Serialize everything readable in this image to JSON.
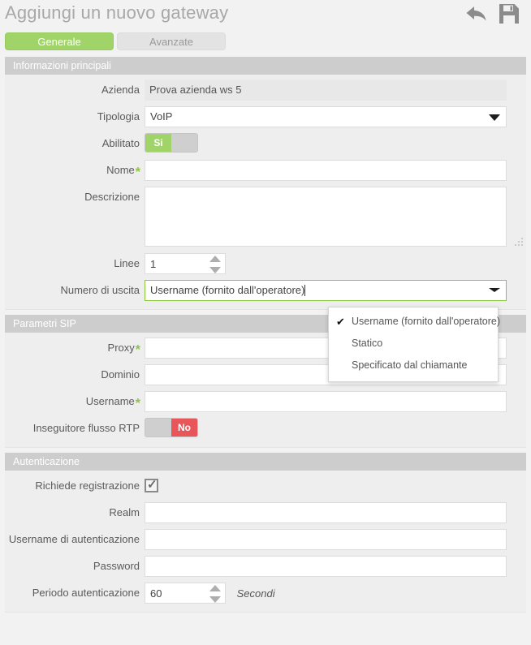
{
  "header": {
    "title": "Aggiungi un nuovo gateway",
    "actions": [
      {
        "name": "back-icon",
        "label": "Indietro"
      },
      {
        "name": "save-icon",
        "label": "Salva"
      }
    ]
  },
  "tabs": [
    {
      "label": "Generale",
      "active": true
    },
    {
      "label": "Avanzate",
      "active": false
    }
  ],
  "sections": {
    "main_info": {
      "title": "Informazioni principali",
      "azienda": {
        "label": "Azienda",
        "value": "Prova azienda ws 5"
      },
      "tipologia": {
        "label": "Tipologia",
        "value": "VoIP"
      },
      "abilitato": {
        "label": "Abilitato",
        "value": "Si",
        "state": "on"
      },
      "nome": {
        "label": "Nome",
        "value": "",
        "required": "*"
      },
      "descrizione": {
        "label": "Descrizione",
        "value": ""
      },
      "linee": {
        "label": "Linee",
        "value": "1"
      },
      "numero_uscita": {
        "label": "Numero di uscita",
        "value": "Username (fornito dall'operatore)",
        "options": [
          {
            "label": "Username (fornito dall'operatore)",
            "selected": true
          },
          {
            "label": "Statico",
            "selected": false
          },
          {
            "label": "Specificato dal chiamante",
            "selected": false
          }
        ]
      }
    },
    "sip": {
      "title": "Parametri SIP",
      "proxy": {
        "label": "Proxy",
        "value": "",
        "required": "*"
      },
      "dominio": {
        "label": "Dominio",
        "value": ""
      },
      "username": {
        "label": "Username",
        "value": "",
        "required": "*"
      },
      "rtp": {
        "label": "Inseguitore flusso RTP",
        "value": "No",
        "state": "off"
      }
    },
    "auth": {
      "title": "Autenticazione",
      "richiede_registrazione": {
        "label": "Richiede registrazione",
        "checked": true
      },
      "realm": {
        "label": "Realm",
        "value": ""
      },
      "auth_username": {
        "label": "Username di autenticazione",
        "value": ""
      },
      "password": {
        "label": "Password",
        "value": ""
      },
      "periodo": {
        "label": "Periodo autenticazione",
        "value": "60",
        "unit": "Secondi"
      }
    }
  },
  "toggle_labels": {
    "on": "Si",
    "off": "No"
  },
  "colors": {
    "accent_green": "#a0d468",
    "danger_red": "#e8565a",
    "section_gray": "#cdcdcd",
    "required_star": "#8cc63e"
  }
}
